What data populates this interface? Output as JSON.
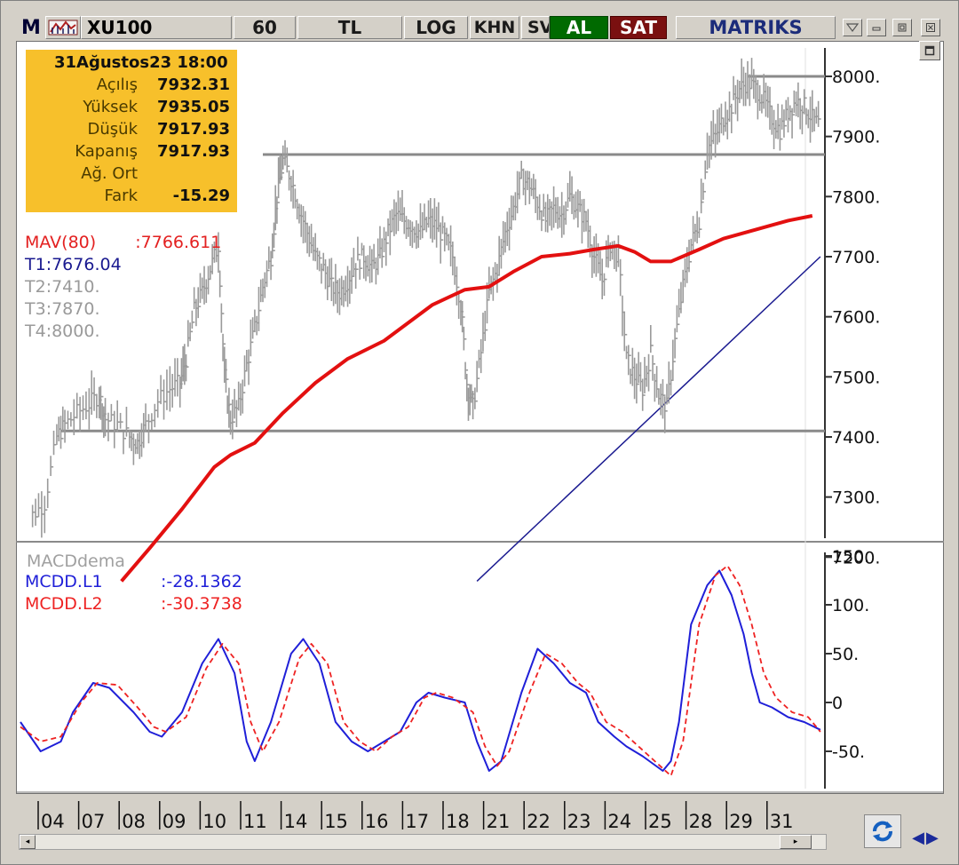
{
  "toolbar": {
    "logo": "M",
    "symbol": "XU100",
    "period": "60",
    "currency": "TL",
    "log": "LOG",
    "khn": "KHN",
    "sv": "SV",
    "buy": "AL",
    "sell": "SAT",
    "brand": "MATRIKS",
    "buy_color": "#006a00",
    "sell_color": "#7a1010"
  },
  "info_box": {
    "date": "31Ağustos23 18:00",
    "rows": [
      {
        "label": "Açılış",
        "value": "7932.31"
      },
      {
        "label": "Yüksek",
        "value": "7935.05"
      },
      {
        "label": "Düşük",
        "value": "7917.93"
      },
      {
        "label": "Kapanış",
        "value": "7917.93"
      },
      {
        "label": "Ağ. Ort",
        "value": ""
      },
      {
        "label": "Fark",
        "value": "-15.29"
      }
    ]
  },
  "legend_main": {
    "mav_label": "MAV(80)",
    "mav_value": ":7766.611",
    "t1": "T1:7676.04",
    "t2": "T2:7410.",
    "t3": "T3:7870.",
    "t4": "T4:8000."
  },
  "legend_macd": {
    "title": "MACDdema",
    "l1_label": "MCDD.L1",
    "l1_value": ":-28.1362",
    "l2_label": "MCDD.L2",
    "l2_value": ":-30.3738"
  },
  "icons": [
    "chart-symbol-icon",
    "minimize-icon",
    "restore-icon",
    "close-icon",
    "dropdown-icon",
    "refresh-icon",
    "scroll-left-icon",
    "scroll-right-icon",
    "nav-arrows-icon",
    "maximize-panel-icon"
  ],
  "chart_data": [
    {
      "type": "ohlc",
      "ylim": [
        7160,
        8060
      ],
      "yticks": [
        "8000.",
        "7900.",
        "7800.",
        "7700.",
        "7600.",
        "7500.",
        "7400.",
        "7300.",
        "7200."
      ],
      "x_ticks": [
        "04",
        "07",
        "08",
        "09",
        "10",
        "11",
        "14",
        "15",
        "16",
        "17",
        "18",
        "21",
        "22",
        "23",
        "24",
        "25",
        "28",
        "29",
        "31"
      ],
      "horizontal_levels": [
        {
          "name": "T2",
          "value": 7410,
          "from_day": 1
        },
        {
          "name": "T3",
          "value": 7870,
          "from_day": 6
        },
        {
          "name": "T4",
          "value": 8000,
          "from_day": 18
        }
      ],
      "trendline": {
        "name": "T1",
        "start": [
          11.3,
          7160
        ],
        "end": [
          19.8,
          7700
        ]
      },
      "close_series": [
        [
          0.05,
          7240
        ],
        [
          0.3,
          7270
        ],
        [
          0.6,
          7290
        ],
        [
          0.9,
          7400
        ],
        [
          1.1,
          7420
        ],
        [
          1.4,
          7440
        ],
        [
          1.7,
          7455
        ],
        [
          1.95,
          7470
        ],
        [
          2.1,
          7430
        ],
        [
          2.4,
          7420
        ],
        [
          2.7,
          7400
        ],
        [
          2.9,
          7390
        ],
        [
          3.1,
          7420
        ],
        [
          3.4,
          7460
        ],
        [
          3.7,
          7480
        ],
        [
          3.95,
          7490
        ],
        [
          4.1,
          7530
        ],
        [
          4.3,
          7610
        ],
        [
          4.5,
          7640
        ],
        [
          4.7,
          7680
        ],
        [
          4.9,
          7720
        ],
        [
          5.05,
          7500
        ],
        [
          5.2,
          7430
        ],
        [
          5.4,
          7450
        ],
        [
          5.6,
          7520
        ],
        [
          5.8,
          7580
        ],
        [
          6.0,
          7650
        ],
        [
          6.2,
          7700
        ],
        [
          6.35,
          7800
        ],
        [
          6.5,
          7860
        ],
        [
          6.7,
          7830
        ],
        [
          6.9,
          7780
        ],
        [
          7.1,
          7740
        ],
        [
          7.3,
          7700
        ],
        [
          7.5,
          7680
        ],
        [
          7.7,
          7650
        ],
        [
          7.9,
          7640
        ],
        [
          8.1,
          7660
        ],
        [
          8.3,
          7690
        ],
        [
          8.5,
          7700
        ],
        [
          8.7,
          7680
        ],
        [
          8.9,
          7700
        ],
        [
          9.1,
          7740
        ],
        [
          9.3,
          7770
        ],
        [
          9.5,
          7760
        ],
        [
          9.7,
          7750
        ],
        [
          9.9,
          7740
        ],
        [
          10.1,
          7760
        ],
        [
          10.3,
          7750
        ],
        [
          10.5,
          7730
        ],
        [
          10.7,
          7700
        ],
        [
          10.9,
          7620
        ],
        [
          11.05,
          7490
        ],
        [
          11.2,
          7450
        ],
        [
          11.4,
          7540
        ],
        [
          11.6,
          7640
        ],
        [
          11.8,
          7680
        ],
        [
          12.0,
          7740
        ],
        [
          12.2,
          7780
        ],
        [
          12.4,
          7830
        ],
        [
          12.6,
          7820
        ],
        [
          12.8,
          7790
        ],
        [
          13.0,
          7760
        ],
        [
          13.2,
          7780
        ],
        [
          13.4,
          7770
        ],
        [
          13.6,
          7800
        ],
        [
          13.8,
          7780
        ],
        [
          14.0,
          7760
        ],
        [
          14.2,
          7700
        ],
        [
          14.4,
          7660
        ],
        [
          14.6,
          7720
        ],
        [
          14.8,
          7700
        ],
        [
          15.0,
          7530
        ],
        [
          15.2,
          7500
        ],
        [
          15.4,
          7480
        ],
        [
          15.6,
          7540
        ],
        [
          15.8,
          7470
        ],
        [
          16.0,
          7450
        ],
        [
          16.2,
          7560
        ],
        [
          16.4,
          7650
        ],
        [
          16.6,
          7720
        ],
        [
          16.8,
          7760
        ],
        [
          17.0,
          7880
        ],
        [
          17.2,
          7900
        ],
        [
          17.4,
          7930
        ],
        [
          17.6,
          7950
        ],
        [
          17.8,
          7980
        ],
        [
          18.0,
          7990
        ],
        [
          18.2,
          7980
        ],
        [
          18.4,
          7960
        ],
        [
          18.6,
          7930
        ],
        [
          18.8,
          7910
        ],
        [
          19.0,
          7940
        ],
        [
          19.2,
          7960
        ],
        [
          19.4,
          7950
        ],
        [
          19.6,
          7930
        ],
        [
          19.8,
          7918
        ]
      ],
      "mav80": [
        [
          2.5,
          7160
        ],
        [
          3.2,
          7215
        ],
        [
          4.0,
          7280
        ],
        [
          4.8,
          7350
        ],
        [
          5.2,
          7370
        ],
        [
          5.8,
          7390
        ],
        [
          6.5,
          7440
        ],
        [
          7.3,
          7490
        ],
        [
          8.1,
          7530
        ],
        [
          9.0,
          7560
        ],
        [
          10.2,
          7620
        ],
        [
          11.0,
          7645
        ],
        [
          11.6,
          7650
        ],
        [
          12.2,
          7675
        ],
        [
          12.9,
          7700
        ],
        [
          13.6,
          7705
        ],
        [
          14.2,
          7712
        ],
        [
          14.8,
          7718
        ],
        [
          15.2,
          7708
        ],
        [
          15.6,
          7692
        ],
        [
          16.1,
          7692
        ],
        [
          16.8,
          7712
        ],
        [
          17.4,
          7730
        ],
        [
          18.2,
          7745
        ],
        [
          19.0,
          7760
        ],
        [
          19.6,
          7768
        ]
      ],
      "legend": [
        "MAV(80)",
        "T1:7676.04",
        "T2:7410.",
        "T3:7870.",
        "T4:8000."
      ],
      "info_box": {
        "date": "31Ağustos23 18:00",
        "open": 7932.31,
        "high": 7935.05,
        "low": 7917.93,
        "close": 7917.93,
        "change": -15.29
      }
    },
    {
      "type": "line",
      "title": "MACDdema",
      "ylim": [
        -90,
        155
      ],
      "yticks": [
        "150.",
        "100.",
        "50.",
        "0",
        "-50."
      ],
      "series": [
        {
          "name": "MCDD.L1",
          "color": "#1f1fd8",
          "style": "solid",
          "last": -28.1362,
          "points": [
            [
              0.0,
              -20
            ],
            [
              0.5,
              -50
            ],
            [
              1.0,
              -40
            ],
            [
              1.3,
              -10
            ],
            [
              1.8,
              20
            ],
            [
              2.2,
              15
            ],
            [
              2.8,
              -10
            ],
            [
              3.2,
              -30
            ],
            [
              3.5,
              -35
            ],
            [
              4.0,
              -10
            ],
            [
              4.5,
              40
            ],
            [
              4.9,
              65
            ],
            [
              5.3,
              30
            ],
            [
              5.6,
              -40
            ],
            [
              5.8,
              -60
            ],
            [
              6.2,
              -20
            ],
            [
              6.7,
              50
            ],
            [
              7.0,
              65
            ],
            [
              7.4,
              40
            ],
            [
              7.8,
              -20
            ],
            [
              8.2,
              -40
            ],
            [
              8.6,
              -50
            ],
            [
              9.0,
              -40
            ],
            [
              9.4,
              -30
            ],
            [
              9.8,
              0
            ],
            [
              10.1,
              10
            ],
            [
              10.5,
              5
            ],
            [
              11.0,
              0
            ],
            [
              11.3,
              -40
            ],
            [
              11.6,
              -70
            ],
            [
              11.9,
              -60
            ],
            [
              12.4,
              10
            ],
            [
              12.8,
              55
            ],
            [
              13.2,
              40
            ],
            [
              13.6,
              20
            ],
            [
              14.0,
              10
            ],
            [
              14.3,
              -20
            ],
            [
              14.7,
              -35
            ],
            [
              15.0,
              -45
            ],
            [
              15.4,
              -55
            ],
            [
              15.9,
              -70
            ],
            [
              16.1,
              -60
            ],
            [
              16.3,
              -20
            ],
            [
              16.6,
              80
            ],
            [
              17.0,
              120
            ],
            [
              17.3,
              135
            ],
            [
              17.6,
              110
            ],
            [
              17.9,
              70
            ],
            [
              18.1,
              30
            ],
            [
              18.3,
              0
            ],
            [
              18.6,
              -5
            ],
            [
              19.0,
              -15
            ],
            [
              19.4,
              -20
            ],
            [
              19.8,
              -28
            ]
          ]
        },
        {
          "name": "MCDD.L2",
          "color": "#ee2222",
          "style": "dashed",
          "last": -30.3738,
          "points": [
            [
              0.0,
              -25
            ],
            [
              0.5,
              -40
            ],
            [
              1.0,
              -35
            ],
            [
              1.5,
              0
            ],
            [
              1.9,
              20
            ],
            [
              2.4,
              18
            ],
            [
              2.9,
              -5
            ],
            [
              3.3,
              -25
            ],
            [
              3.6,
              -30
            ],
            [
              4.1,
              -15
            ],
            [
              4.6,
              35
            ],
            [
              5.0,
              60
            ],
            [
              5.4,
              40
            ],
            [
              5.7,
              -20
            ],
            [
              6.0,
              -50
            ],
            [
              6.4,
              -20
            ],
            [
              6.9,
              45
            ],
            [
              7.2,
              60
            ],
            [
              7.6,
              40
            ],
            [
              8.0,
              -20
            ],
            [
              8.4,
              -40
            ],
            [
              8.8,
              -50
            ],
            [
              9.2,
              -35
            ],
            [
              9.6,
              -25
            ],
            [
              10.0,
              5
            ],
            [
              10.3,
              10
            ],
            [
              10.7,
              5
            ],
            [
              11.2,
              -10
            ],
            [
              11.5,
              -45
            ],
            [
              11.8,
              -65
            ],
            [
              12.1,
              -50
            ],
            [
              12.6,
              10
            ],
            [
              13.0,
              50
            ],
            [
              13.4,
              40
            ],
            [
              13.8,
              20
            ],
            [
              14.1,
              10
            ],
            [
              14.5,
              -20
            ],
            [
              14.9,
              -30
            ],
            [
              15.3,
              -45
            ],
            [
              15.7,
              -60
            ],
            [
              16.1,
              -75
            ],
            [
              16.4,
              -40
            ],
            [
              16.8,
              80
            ],
            [
              17.2,
              130
            ],
            [
              17.5,
              140
            ],
            [
              17.8,
              120
            ],
            [
              18.1,
              80
            ],
            [
              18.4,
              30
            ],
            [
              18.7,
              5
            ],
            [
              19.1,
              -10
            ],
            [
              19.5,
              -15
            ],
            [
              19.8,
              -30
            ]
          ]
        }
      ]
    }
  ]
}
